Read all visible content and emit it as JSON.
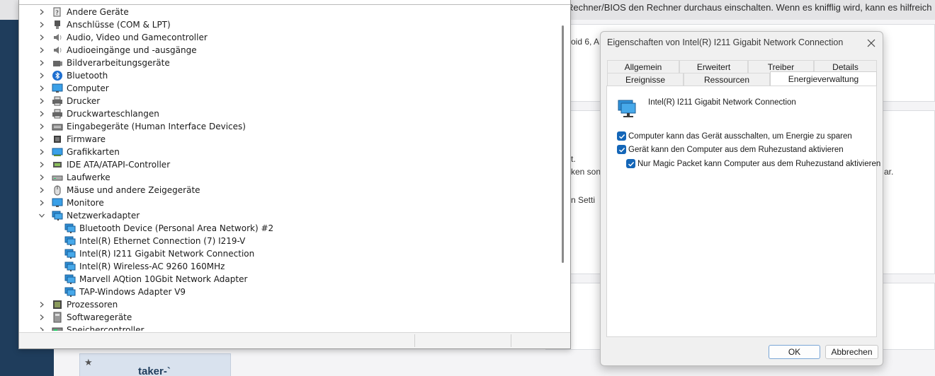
{
  "background": {
    "top_text": "Rechner/BIOS den Rechner durchaus einschalten. Wenn es knifflig wird, kann es hilfreich",
    "snippets": [
      "oid 6, A",
      "t.",
      "ken son",
      "ar.",
      "n Setti"
    ],
    "user_name": "taker-`",
    "star_icon": "star-icon"
  },
  "device_manager": {
    "categories": [
      {
        "label": "Andere Geräte",
        "icon": "unknown-device-icon",
        "expanded": false
      },
      {
        "label": "Anschlüsse (COM & LPT)",
        "icon": "port-icon",
        "expanded": false
      },
      {
        "label": "Audio, Video und Gamecontroller",
        "icon": "speaker-icon",
        "expanded": false
      },
      {
        "label": "Audioeingänge und -ausgänge",
        "icon": "speaker-icon",
        "expanded": false
      },
      {
        "label": "Bildverarbeitungsgeräte",
        "icon": "camera-icon",
        "expanded": false
      },
      {
        "label": "Bluetooth",
        "icon": "bluetooth-icon",
        "expanded": false
      },
      {
        "label": "Computer",
        "icon": "monitor-icon",
        "expanded": false
      },
      {
        "label": "Drucker",
        "icon": "printer-icon",
        "expanded": false
      },
      {
        "label": "Druckwarteschlangen",
        "icon": "printer-icon",
        "expanded": false
      },
      {
        "label": "Eingabegeräte (Human Interface Devices)",
        "icon": "keyboard-icon",
        "expanded": false
      },
      {
        "label": "Firmware",
        "icon": "chip-icon",
        "expanded": false
      },
      {
        "label": "Grafikkarten",
        "icon": "display-adapter-icon",
        "expanded": false
      },
      {
        "label": "IDE ATA/ATAPI-Controller",
        "icon": "controller-icon",
        "expanded": false
      },
      {
        "label": "Laufwerke",
        "icon": "drive-icon",
        "expanded": false
      },
      {
        "label": "Mäuse und andere Zeigegeräte",
        "icon": "mouse-icon",
        "expanded": false
      },
      {
        "label": "Monitore",
        "icon": "monitor-icon",
        "expanded": false
      },
      {
        "label": "Netzwerkadapter",
        "icon": "network-adapter-icon",
        "expanded": true
      },
      {
        "label": "Prozessoren",
        "icon": "cpu-icon",
        "expanded": false
      },
      {
        "label": "Softwaregeräte",
        "icon": "software-device-icon",
        "expanded": false
      },
      {
        "label": "Speichercontroller",
        "icon": "storage-controller-icon",
        "expanded": false
      }
    ],
    "network_adapters": [
      "Bluetooth Device (Personal Area Network) #2",
      "Intel(R) Ethernet Connection (7) I219-V",
      "Intel(R) I211 Gigabit Network Connection",
      "Intel(R) Wireless-AC 9260 160MHz",
      "Marvell AQtion 10Gbit Network Adapter",
      "TAP-Windows Adapter V9"
    ]
  },
  "dialog": {
    "title": "Eigenschaften von Intel(R) I211 Gigabit Network Connection",
    "tabs_row1": [
      "Allgemein",
      "Erweitert",
      "Treiber",
      "Details"
    ],
    "tabs_row2": [
      "Ereignisse",
      "Ressourcen",
      "Energieverwaltung"
    ],
    "active_tab": "Energieverwaltung",
    "device_name": "Intel(R) I211 Gigabit Network Connection",
    "options": [
      {
        "label": "Computer kann das Gerät ausschalten, um Energie zu sparen",
        "checked": true
      },
      {
        "label": "Gerät kann den Computer aus dem Ruhezustand aktivieren",
        "checked": true
      },
      {
        "label": "Nur Magic Packet kann Computer aus dem Ruhezustand aktivieren",
        "checked": true
      }
    ],
    "ok_label": "OK",
    "cancel_label": "Abbrechen"
  },
  "colors": {
    "accent": "#1466b8",
    "page_sidebar": "#1f3d5c"
  }
}
